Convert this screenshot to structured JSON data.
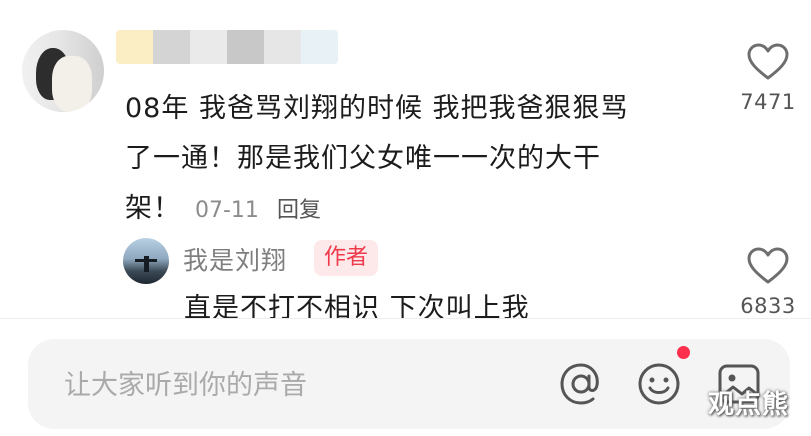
{
  "comments": [
    {
      "text_lines": [
        "08年 我爸骂刘翔的时候 我把我爸狠狠骂",
        "了一通！那是我们父女唯一一次的大干",
        "架！"
      ],
      "date": "07-11",
      "reply_label": "回复",
      "likes": "7471"
    }
  ],
  "reply": {
    "user": "我是刘翔",
    "badge": "作者",
    "text": "直是不打不相识 下次叫上我",
    "likes": "6833"
  },
  "bottom_bar": {
    "placeholder": "让大家听到你的声音",
    "icons": [
      "at-icon",
      "emoji-icon",
      "image-icon"
    ],
    "notification_dot_color": "#ff2e4d"
  },
  "watermark": "观点熊",
  "colors": {
    "author_badge_bg": "#fde8ea",
    "author_badge_text": "#ee3a4a"
  }
}
